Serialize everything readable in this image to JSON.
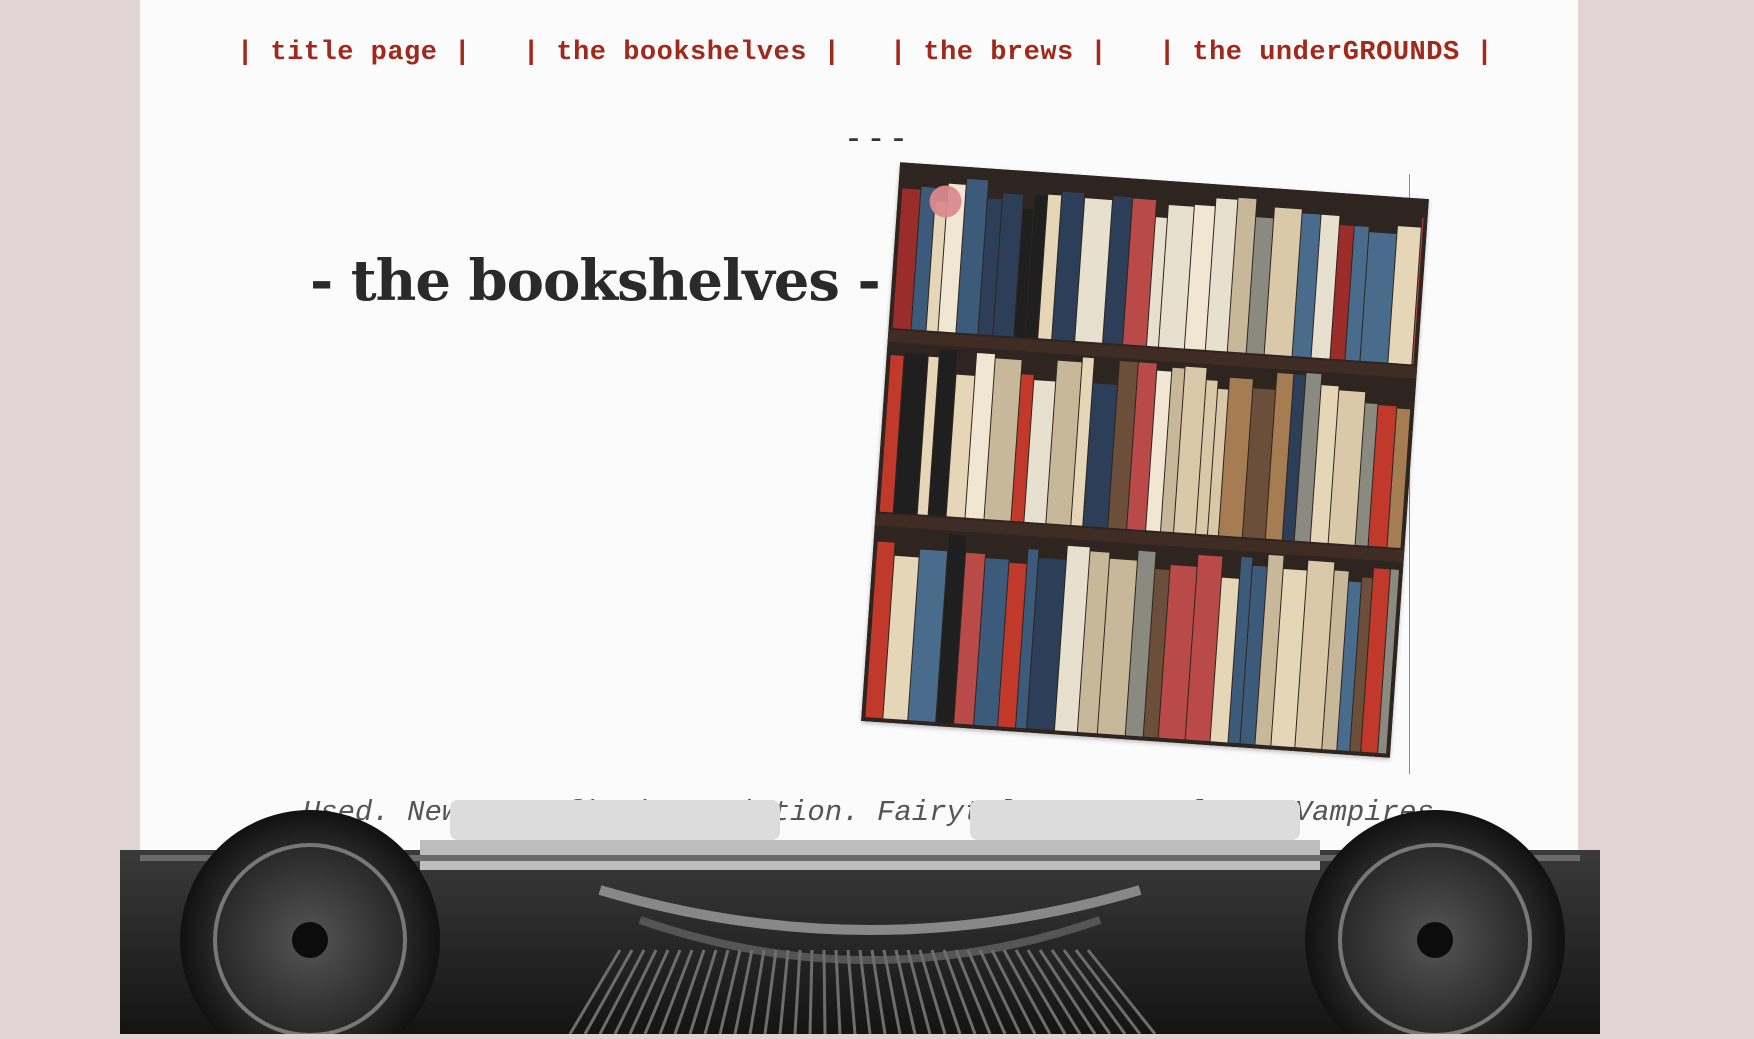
{
  "nav": {
    "items": [
      {
        "label": "| title page |"
      },
      {
        "label": "| the bookshelves |"
      },
      {
        "label": "| the brews |"
      },
      {
        "label": "| the underGROUNDS |"
      }
    ]
  },
  "divider": "---",
  "heading": "- the bookshelves -",
  "tagline": "Used. New. Non-fiction. Fiction. Fairytales. Werewolves. Vampires.",
  "images": {
    "bookshelf_photo": "bookshelf-photo",
    "typewriter": "typewriter-image"
  },
  "colors": {
    "background": "#e2d3d6",
    "paper": "#fbfbfb",
    "nav_link": "#a2281b"
  }
}
